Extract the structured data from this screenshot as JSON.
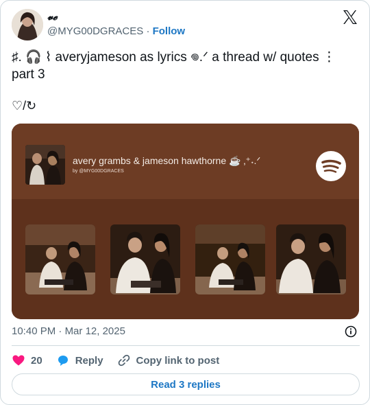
{
  "author": {
    "display_name": "𝓿𝓮",
    "handle": "@MYG00DGRACES",
    "separator": "·",
    "follow_label": "Follow"
  },
  "tweet": {
    "line1": "♯. 🎧 ⌇ averyjameson as lyrics 𖦹.ᐟ a thread w/ quotes ⋮",
    "line2": "part 3",
    "line3": "♡/↻"
  },
  "embed": {
    "playlist_title": "avery grambs & jameson hawthorne ☕ ‚⁺˖.ᐟ",
    "playlist_by": "by @MYG00DGRACES",
    "service_icon": "spotify-icon",
    "colors": {
      "top": "#6d3c24",
      "bottom": "#5e311c",
      "text": "#f4ece6"
    }
  },
  "meta": {
    "time": "10:40 PM",
    "separator": "·",
    "date": "Mar 12, 2025"
  },
  "actions": {
    "like_count": "20",
    "reply_label": "Reply",
    "copy_label": "Copy link to post"
  },
  "read_replies_label": "Read 3 replies",
  "colors": {
    "accent": "#1d77c4",
    "like": "#f91880",
    "muted": "#536471",
    "border": "#cfd9de"
  }
}
